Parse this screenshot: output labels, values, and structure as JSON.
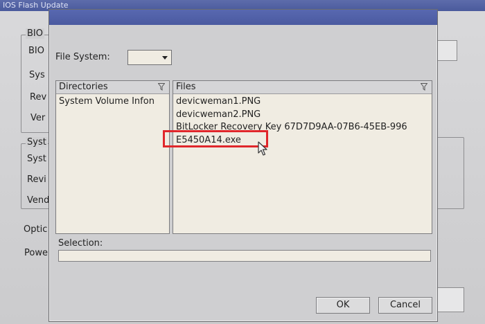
{
  "background": {
    "title": "IOS Flash Update",
    "groups": [
      {
        "legend": "BIO",
        "labels": [
          "BIO",
          "Sys",
          "Rev",
          "Ver"
        ]
      },
      {
        "legend": "Syst",
        "labels": [
          "Syst",
          "Revi",
          "Vend"
        ]
      }
    ],
    "extra_labels": [
      "Optic",
      "Powe"
    ]
  },
  "dialog": {
    "file_system_label": "File System:",
    "file_system_value": "",
    "directories": {
      "header": "Directories",
      "items": [
        "System Volume Infon"
      ]
    },
    "files": {
      "header": "Files",
      "items": [
        "devicweman1.PNG",
        "devicweman2.PNG",
        "BitLocker Recovery Key 67D7D9AA-07B6-45EB-996",
        "E5450A14.exe"
      ]
    },
    "selection_label": "Selection:",
    "selection_value": "",
    "ok_label": "OK",
    "cancel_label": "Cancel"
  },
  "colors": {
    "titlebar": "#5868b0",
    "panel_bg": "#f0ece2",
    "highlight": "#e0262b"
  },
  "icons": {
    "filter": "filter-icon",
    "dropdown": "chevron-down-icon",
    "cursor": "mouse-pointer-icon"
  }
}
